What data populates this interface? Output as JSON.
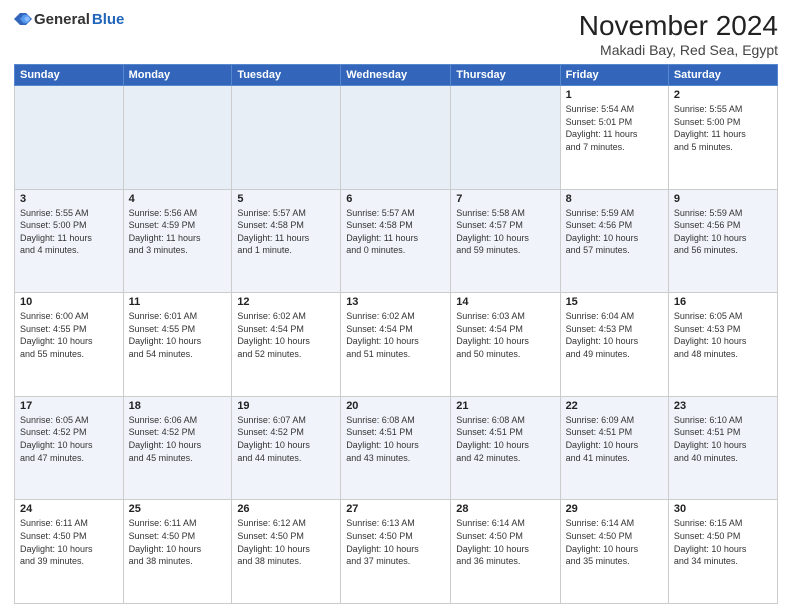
{
  "logo": {
    "general": "General",
    "blue": "Blue"
  },
  "header": {
    "month": "November 2024",
    "location": "Makadi Bay, Red Sea, Egypt"
  },
  "weekdays": [
    "Sunday",
    "Monday",
    "Tuesday",
    "Wednesday",
    "Thursday",
    "Friday",
    "Saturday"
  ],
  "weeks": [
    [
      {
        "day": "",
        "info": ""
      },
      {
        "day": "",
        "info": ""
      },
      {
        "day": "",
        "info": ""
      },
      {
        "day": "",
        "info": ""
      },
      {
        "day": "",
        "info": ""
      },
      {
        "day": "1",
        "info": "Sunrise: 5:54 AM\nSunset: 5:01 PM\nDaylight: 11 hours\nand 7 minutes."
      },
      {
        "day": "2",
        "info": "Sunrise: 5:55 AM\nSunset: 5:00 PM\nDaylight: 11 hours\nand 5 minutes."
      }
    ],
    [
      {
        "day": "3",
        "info": "Sunrise: 5:55 AM\nSunset: 5:00 PM\nDaylight: 11 hours\nand 4 minutes."
      },
      {
        "day": "4",
        "info": "Sunrise: 5:56 AM\nSunset: 4:59 PM\nDaylight: 11 hours\nand 3 minutes."
      },
      {
        "day": "5",
        "info": "Sunrise: 5:57 AM\nSunset: 4:58 PM\nDaylight: 11 hours\nand 1 minute."
      },
      {
        "day": "6",
        "info": "Sunrise: 5:57 AM\nSunset: 4:58 PM\nDaylight: 11 hours\nand 0 minutes."
      },
      {
        "day": "7",
        "info": "Sunrise: 5:58 AM\nSunset: 4:57 PM\nDaylight: 10 hours\nand 59 minutes."
      },
      {
        "day": "8",
        "info": "Sunrise: 5:59 AM\nSunset: 4:56 PM\nDaylight: 10 hours\nand 57 minutes."
      },
      {
        "day": "9",
        "info": "Sunrise: 5:59 AM\nSunset: 4:56 PM\nDaylight: 10 hours\nand 56 minutes."
      }
    ],
    [
      {
        "day": "10",
        "info": "Sunrise: 6:00 AM\nSunset: 4:55 PM\nDaylight: 10 hours\nand 55 minutes."
      },
      {
        "day": "11",
        "info": "Sunrise: 6:01 AM\nSunset: 4:55 PM\nDaylight: 10 hours\nand 54 minutes."
      },
      {
        "day": "12",
        "info": "Sunrise: 6:02 AM\nSunset: 4:54 PM\nDaylight: 10 hours\nand 52 minutes."
      },
      {
        "day": "13",
        "info": "Sunrise: 6:02 AM\nSunset: 4:54 PM\nDaylight: 10 hours\nand 51 minutes."
      },
      {
        "day": "14",
        "info": "Sunrise: 6:03 AM\nSunset: 4:54 PM\nDaylight: 10 hours\nand 50 minutes."
      },
      {
        "day": "15",
        "info": "Sunrise: 6:04 AM\nSunset: 4:53 PM\nDaylight: 10 hours\nand 49 minutes."
      },
      {
        "day": "16",
        "info": "Sunrise: 6:05 AM\nSunset: 4:53 PM\nDaylight: 10 hours\nand 48 minutes."
      }
    ],
    [
      {
        "day": "17",
        "info": "Sunrise: 6:05 AM\nSunset: 4:52 PM\nDaylight: 10 hours\nand 47 minutes."
      },
      {
        "day": "18",
        "info": "Sunrise: 6:06 AM\nSunset: 4:52 PM\nDaylight: 10 hours\nand 45 minutes."
      },
      {
        "day": "19",
        "info": "Sunrise: 6:07 AM\nSunset: 4:52 PM\nDaylight: 10 hours\nand 44 minutes."
      },
      {
        "day": "20",
        "info": "Sunrise: 6:08 AM\nSunset: 4:51 PM\nDaylight: 10 hours\nand 43 minutes."
      },
      {
        "day": "21",
        "info": "Sunrise: 6:08 AM\nSunset: 4:51 PM\nDaylight: 10 hours\nand 42 minutes."
      },
      {
        "day": "22",
        "info": "Sunrise: 6:09 AM\nSunset: 4:51 PM\nDaylight: 10 hours\nand 41 minutes."
      },
      {
        "day": "23",
        "info": "Sunrise: 6:10 AM\nSunset: 4:51 PM\nDaylight: 10 hours\nand 40 minutes."
      }
    ],
    [
      {
        "day": "24",
        "info": "Sunrise: 6:11 AM\nSunset: 4:50 PM\nDaylight: 10 hours\nand 39 minutes."
      },
      {
        "day": "25",
        "info": "Sunrise: 6:11 AM\nSunset: 4:50 PM\nDaylight: 10 hours\nand 38 minutes."
      },
      {
        "day": "26",
        "info": "Sunrise: 6:12 AM\nSunset: 4:50 PM\nDaylight: 10 hours\nand 38 minutes."
      },
      {
        "day": "27",
        "info": "Sunrise: 6:13 AM\nSunset: 4:50 PM\nDaylight: 10 hours\nand 37 minutes."
      },
      {
        "day": "28",
        "info": "Sunrise: 6:14 AM\nSunset: 4:50 PM\nDaylight: 10 hours\nand 36 minutes."
      },
      {
        "day": "29",
        "info": "Sunrise: 6:14 AM\nSunset: 4:50 PM\nDaylight: 10 hours\nand 35 minutes."
      },
      {
        "day": "30",
        "info": "Sunrise: 6:15 AM\nSunset: 4:50 PM\nDaylight: 10 hours\nand 34 minutes."
      }
    ]
  ]
}
